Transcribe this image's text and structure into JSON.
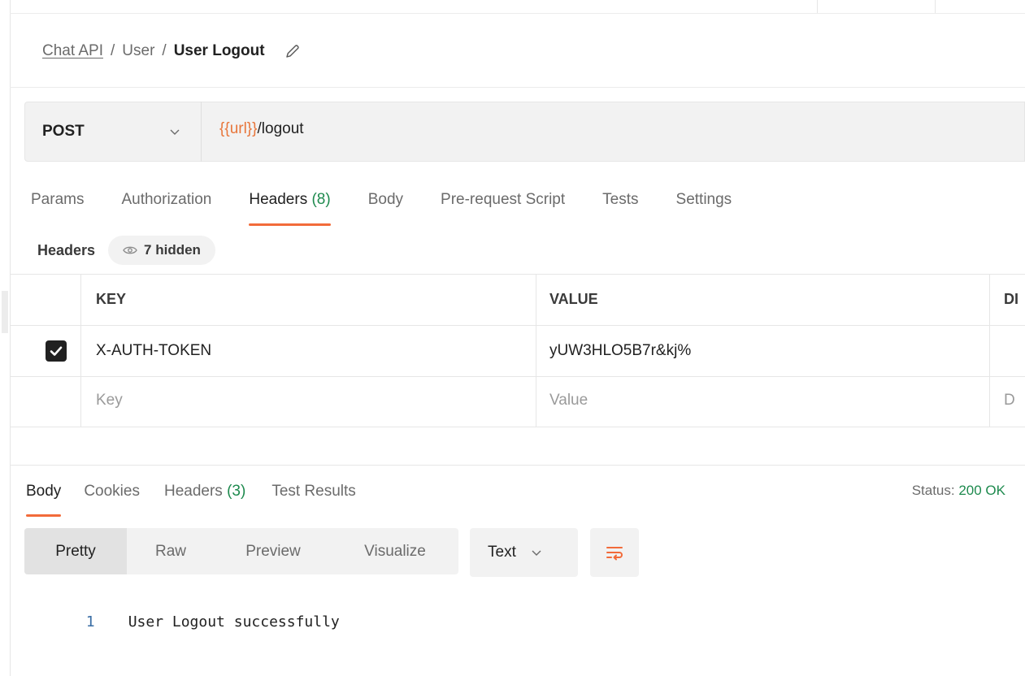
{
  "breadcrumb": {
    "collection": "Chat API",
    "folder": "User",
    "request": "User Logout",
    "separator": "/"
  },
  "request": {
    "method": "POST",
    "url_var": "{{url}}",
    "url_path": "/logout"
  },
  "request_tabs": [
    {
      "label": "Params",
      "count": ""
    },
    {
      "label": "Authorization",
      "count": ""
    },
    {
      "label": "Headers",
      "count": "(8)",
      "active": true
    },
    {
      "label": "Body",
      "count": ""
    },
    {
      "label": "Pre-request Script",
      "count": ""
    },
    {
      "label": "Tests",
      "count": ""
    },
    {
      "label": "Settings",
      "count": ""
    }
  ],
  "headers_section": {
    "label": "Headers",
    "hidden_label": "7 hidden"
  },
  "headers_table": {
    "columns": [
      "KEY",
      "VALUE",
      "DI"
    ],
    "rows": [
      {
        "checked": true,
        "key": "X-AUTH-TOKEN",
        "value": "yUW3HLO5B7r&kj%",
        "description": ""
      }
    ],
    "placeholders": {
      "key": "Key",
      "value": "Value",
      "description": "D"
    }
  },
  "response_tabs": [
    {
      "label": "Body",
      "count": "",
      "active": true
    },
    {
      "label": "Cookies",
      "count": ""
    },
    {
      "label": "Headers",
      "count": "(3)"
    },
    {
      "label": "Test Results",
      "count": ""
    }
  ],
  "status": {
    "label": "Status:",
    "value": "200 OK"
  },
  "view_modes": [
    "Pretty",
    "Raw",
    "Preview",
    "Visualize"
  ],
  "active_view": "Pretty",
  "format": "Text",
  "response_body": [
    {
      "line": "1",
      "text": "User Logout successfully"
    }
  ],
  "colors": {
    "accent": "#f26b3a",
    "variable": "#e8763b",
    "count_green": "#1e8a4e"
  },
  "icons": {
    "edit": "pencil-icon",
    "method_dropdown": "chevron-down-icon",
    "hidden": "eye-icon",
    "checkbox": "checkmark-icon",
    "wrap": "wrap-lines-icon"
  }
}
